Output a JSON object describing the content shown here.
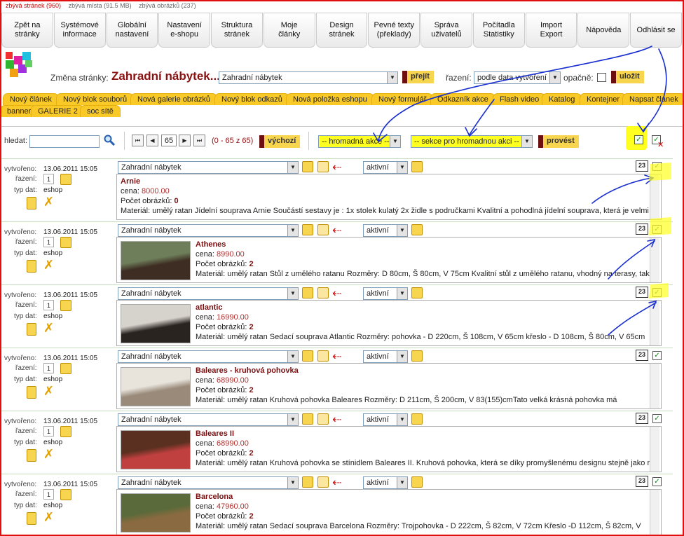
{
  "stats": {
    "pages": "zbývá stránek (960)",
    "space": "zbývá místa (91.5 MB)",
    "images": "zbývá obrázků (237)"
  },
  "nav": [
    "Zpět na\nstránky",
    "Systémové\ninformace",
    "Globální\nnastavení",
    "Nastavení\ne-shopu",
    "Struktura\nstránek",
    "Moje\nčlánky",
    "Design\nstránek",
    "Pevné texty\n(překlady)",
    "Správa\nuživatelů",
    "Počítadla\nStatistiky",
    "Import\nExport",
    "Nápověda",
    "Odhlásit se"
  ],
  "page": {
    "change_label": "Změna stránky:",
    "title": "Zahradní nábytek...",
    "select_value": "Zahradní nábytek",
    "go_label": "přejít",
    "sort_label": "řazení:",
    "sort_value": "podle data vytvoření",
    "reverse_label": "opačně:",
    "save_label": "uložit"
  },
  "tabs": [
    "Nový článek",
    "Nový blok souborů",
    "Nová galerie obrázků",
    "Nový blok odkazů",
    "Nová položka eshopu",
    "Nový formulář",
    "Odkazník akce",
    "Flash video",
    "Katalog",
    "Kontejner",
    "Napsat článek",
    "banner",
    "GALERIE 2",
    "soc sítě"
  ],
  "toolbar": {
    "search_label": "hledat:",
    "page_num": "65",
    "range": "(0 - 65 z 65)",
    "default_label": "výchozí",
    "bulk_action": "-- hromadná akce --",
    "bulk_section": "-- sekce pro hromadnou akci --",
    "execute_label": "provést"
  },
  "labels": {
    "created": "vytvořeno:",
    "order": "řazení:",
    "type": "typ dat:",
    "price_prefix": "cena:",
    "images_prefix": "Počet obrázků:",
    "calendar": "23"
  },
  "items": [
    {
      "date": "13.06.2011 15:05",
      "order": "1",
      "type": "eshop",
      "section": "Zahradní nábytek",
      "status": "aktivní",
      "name": "Arnie",
      "price": "8000.00",
      "images": "0",
      "image_colors": [],
      "desc": "Materiál: umělý ratan Jídelní souprava Arnie Součástí sestavy je : 1x stolek kulatý 2x židle s područkami Kvalitní a pohodlná jídelní souprava, která je velmi"
    },
    {
      "date": "13.06.2011 15:05",
      "order": "1",
      "type": "eshop",
      "section": "Zahradní nábytek",
      "status": "aktivní",
      "name": "Athenes",
      "price": "8990.00",
      "images": "2",
      "image_colors": [
        "#6e7e5a",
        "#3d2d22"
      ],
      "desc": "Materiál: umělý ratan Stůl z umělého ratanu Rozměry: D 80cm, Š 80cm, V 75cm Kvalitní stůl z umělého ratanu, vhodný na terasy, také"
    },
    {
      "date": "13.06.2011 15:05",
      "order": "1",
      "type": "eshop",
      "section": "Zahradní nábytek",
      "status": "aktivní",
      "name": "atlantic",
      "price": "16990.00",
      "images": "2",
      "image_colors": [
        "#d6d2cc",
        "#2a2420"
      ],
      "desc": "Materiál: umělý ratan Sedací souprava Atlantic Rozměry: pohovka - D 220cm, Š 108cm, V 65cm křeslo - D 108cm, Š 80cm, V 65cm"
    },
    {
      "date": "13.06.2011 15:05",
      "order": "1",
      "type": "eshop",
      "section": "Zahradní nábytek",
      "status": "aktivní",
      "name": "Baleares - kruhová pohovka",
      "price": "68990.00",
      "images": "2",
      "image_colors": [
        "#e8e4dc",
        "#9a8a7a"
      ],
      "desc": "Materiál:  umělý  ratan  Kruhová  pohovka  Baleares  Rozměry:  D  211cm,  Š  200cm,  V  83(155)cmTato  velká  krásná  pohovka  má"
    },
    {
      "date": "13.06.2011 15:05",
      "order": "1",
      "type": "eshop",
      "section": "Zahradní nábytek",
      "status": "aktivní",
      "name": "Baleares II",
      "price": "68990.00",
      "images": "2",
      "image_colors": [
        "#5a3020",
        "#c04040"
      ],
      "desc": "Materiál: umělý ratan Kruhová pohovka se stínidlem Baleares II. Kruhová pohovka, která se díky promyšlenému designu stejně jako má"
    },
    {
      "date": "13.06.2011 15:05",
      "order": "1",
      "type": "eshop",
      "section": "Zahradní nábytek",
      "status": "aktivní",
      "name": "Barcelona",
      "price": "47960.00",
      "images": "2",
      "image_colors": [
        "#5a6a3a",
        "#8a6a40"
      ],
      "desc": "Materiál:  umělý  ratan  Sedací  souprava  Barcelona  Rozměry:  Trojpohovka  -  D  222cm,  Š  82cm,  V  72cm  Křeslo  -D  112cm,  Š  82cm,  V"
    }
  ],
  "colors": {
    "accent_yellow": "#f9c928",
    "dark_red": "#6d0f0f",
    "title_red": "#8b1010",
    "annotation_blue": "#1a2fd0",
    "highlight": "#ffff20"
  }
}
